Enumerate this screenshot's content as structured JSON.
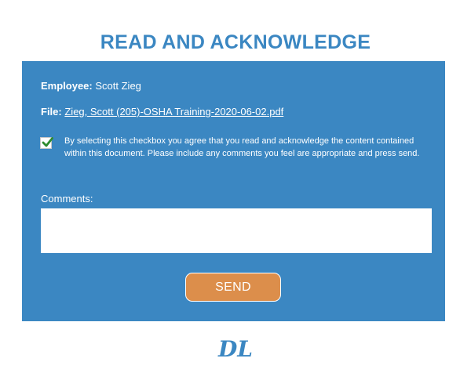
{
  "header": {
    "title": "READ AND ACKNOWLEDGE"
  },
  "form": {
    "employee_label": "Employee:",
    "employee_name": "Scott Zieg",
    "file_label": "File:",
    "file_name": "Zieg, Scott (205)-OSHA Training-2020-06-02.pdf",
    "acknowledge_checked": true,
    "acknowledge_text": "By selecting this checkbox you agree that you read and acknowledge the content contained within this document. Please include any comments you feel are appropriate and press send.",
    "comments_label": "Comments:",
    "comments_value": "",
    "send_label": "SEND"
  },
  "logo": {
    "text": "DL"
  },
  "colors": {
    "primary": "#3b87c2",
    "button": "#dc8e4b",
    "check": "#2e8b2e"
  },
  "icons": {
    "check": "checkmark-icon"
  }
}
